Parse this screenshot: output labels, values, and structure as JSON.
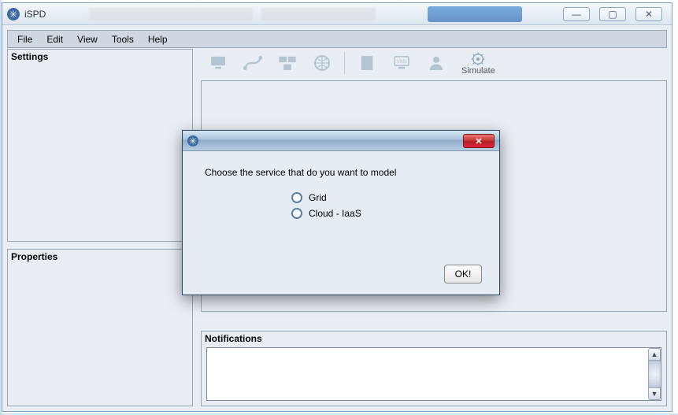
{
  "app": {
    "title": "iSPD"
  },
  "menu": {
    "file": "File",
    "edit": "Edit",
    "view": "View",
    "tools": "Tools",
    "help": "Help"
  },
  "panels": {
    "settings": "Settings",
    "properties": "Properties",
    "notifications": "Notifications"
  },
  "toolbar": {
    "simulate": "Simulate"
  },
  "dialog": {
    "prompt": "Choose the service that do you want to model",
    "option_grid": "Grid",
    "option_cloud": "Cloud - IaaS",
    "ok": "OK!"
  }
}
